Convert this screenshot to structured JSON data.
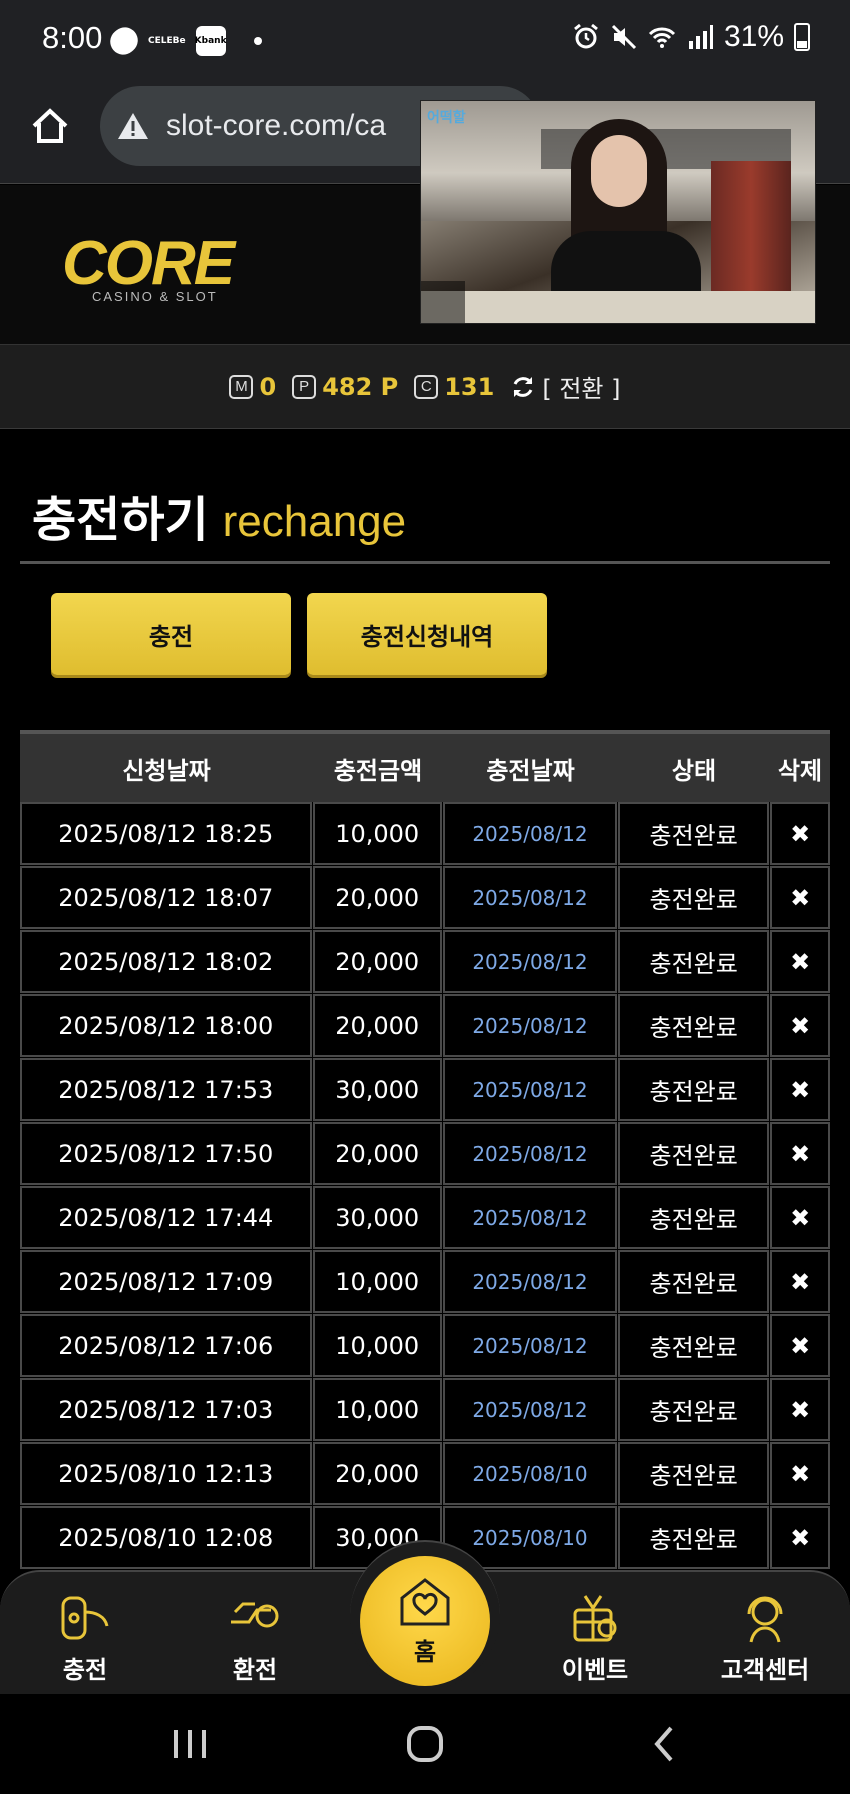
{
  "status_bar": {
    "time": "8:00",
    "celeb_label": "CELEBe",
    "kbank_label": "Kbank",
    "battery": "31%"
  },
  "browser": {
    "url": "slot-core.com/ca"
  },
  "video_overlay": {
    "badge": "어떡할"
  },
  "site": {
    "logo_main": "CORE",
    "logo_sub": "CASINO & SLOT"
  },
  "points": {
    "m_icon": "M",
    "m_value": "0",
    "p_icon": "P",
    "p_value": "482 P",
    "c_icon": "C",
    "c_value": "131",
    "switch_label": "[ 전환 ]"
  },
  "page": {
    "title_ko": "충전하기",
    "title_en": "rechange"
  },
  "actions": {
    "charge_label": "충전",
    "history_label": "충전신청내역"
  },
  "table": {
    "headers": [
      "신청날짜",
      "충전금액",
      "충전날짜",
      "상태",
      "삭제"
    ],
    "delete_glyph": "✖",
    "rows": [
      {
        "request_date": "2025/08/12 18:25",
        "amount": "10,000",
        "charge_date": "2025/08/12",
        "status": "충전완료"
      },
      {
        "request_date": "2025/08/12 18:07",
        "amount": "20,000",
        "charge_date": "2025/08/12",
        "status": "충전완료"
      },
      {
        "request_date": "2025/08/12 18:02",
        "amount": "20,000",
        "charge_date": "2025/08/12",
        "status": "충전완료"
      },
      {
        "request_date": "2025/08/12 18:00",
        "amount": "20,000",
        "charge_date": "2025/08/12",
        "status": "충전완료"
      },
      {
        "request_date": "2025/08/12 17:53",
        "amount": "30,000",
        "charge_date": "2025/08/12",
        "status": "충전완료"
      },
      {
        "request_date": "2025/08/12 17:50",
        "amount": "20,000",
        "charge_date": "2025/08/12",
        "status": "충전완료"
      },
      {
        "request_date": "2025/08/12 17:44",
        "amount": "30,000",
        "charge_date": "2025/08/12",
        "status": "충전완료"
      },
      {
        "request_date": "2025/08/12 17:09",
        "amount": "10,000",
        "charge_date": "2025/08/12",
        "status": "충전완료"
      },
      {
        "request_date": "2025/08/12 17:06",
        "amount": "10,000",
        "charge_date": "2025/08/12",
        "status": "충전완료"
      },
      {
        "request_date": "2025/08/12 17:03",
        "amount": "10,000",
        "charge_date": "2025/08/12",
        "status": "충전완료"
      },
      {
        "request_date": "2025/08/10 12:13",
        "amount": "20,000",
        "charge_date": "2025/08/10",
        "status": "충전완료"
      },
      {
        "request_date": "2025/08/10 12:08",
        "amount": "30,000",
        "charge_date": "2025/08/10",
        "status": "충전완료"
      }
    ]
  },
  "bottom_nav": {
    "items": [
      {
        "label": "충전",
        "icon": "charge-icon"
      },
      {
        "label": "환전",
        "icon": "exchange-icon"
      },
      {
        "label": "홈",
        "icon": "home-heart-icon"
      },
      {
        "label": "이벤트",
        "icon": "gift-icon"
      },
      {
        "label": "고객센터",
        "icon": "support-icon"
      }
    ]
  },
  "colors": {
    "accent_gold": "#e8c53a",
    "date_blue": "#7ea9e6",
    "background": "#000000"
  }
}
